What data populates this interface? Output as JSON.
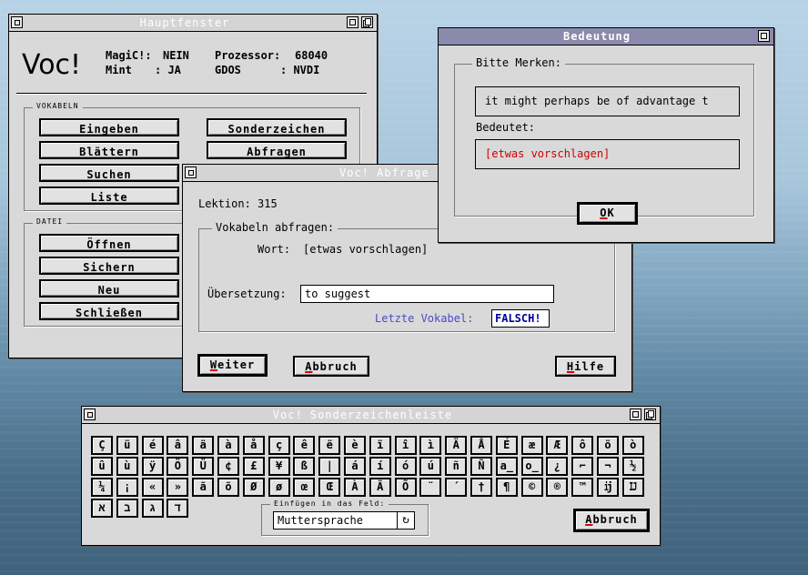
{
  "main_window": {
    "title": "Hauptfenster",
    "logo": "Voc!",
    "info": {
      "magic_label": "MagiC!:",
      "magic_value": "NEIN",
      "mint_label": "Mint",
      "mint_value": ": JA",
      "cpu_label": "Prozessor:",
      "cpu_value": "68040",
      "gdos_label": "GDOS",
      "gdos_value": ": NVDI"
    },
    "vokabeln_label": "VOKABELN",
    "vokabeln_buttons": [
      "Eingeben",
      "Blättern",
      "Suchen",
      "Liste"
    ],
    "vokabeln_buttons_right": [
      "Sonderzeichen",
      "Abfragen"
    ],
    "datei_label": "DATEI",
    "datei_buttons": [
      "Öffnen",
      "Sichern",
      "Neu",
      "Schließen"
    ]
  },
  "quiz_window": {
    "title": "Voc!  Abfrage",
    "lektion": "Lektion: 315",
    "group_label": "Vokabeln abfragen:",
    "wort_label": "Wort:",
    "wort_value": "[etwas vorschlagen]",
    "uebersetzung_label": "Übersetzung:",
    "uebersetzung_value": "to suggest",
    "letzte_label": "Letzte Vokabel:",
    "letzte_value": "FALSCH!",
    "btn_weiter_first": "W",
    "btn_weiter_rest": "eiter",
    "btn_abbruch_first": "A",
    "btn_abbruch_rest": "bbruch",
    "btn_hilfe_first": "H",
    "btn_hilfe_rest": "ilfe"
  },
  "meaning_window": {
    "title": "Bedeutung",
    "group_label": "Bitte Merken:",
    "sentence": "it might perhaps be of advantage t",
    "bedeutet_label": "Bedeutet:",
    "bedeutet_value": "[etwas vorschlagen]",
    "ok_first": "O",
    "ok_rest": "K"
  },
  "special_window": {
    "title": "Voc!  Sonderzeichenleiste",
    "row1": [
      "Ç",
      "ü",
      "é",
      "â",
      "ä",
      "à",
      "å",
      "ç",
      "ê",
      "ë",
      "è",
      "ï",
      "î",
      "ì",
      "Ä",
      "Å",
      "É",
      "æ",
      "Æ",
      "ô",
      "ö",
      "ò"
    ],
    "row2": [
      "û",
      "ù",
      "ÿ",
      "Ö",
      "Ü",
      "¢",
      "£",
      "¥",
      "ß",
      "|",
      "á",
      "í",
      "ó",
      "ú",
      "ñ",
      "Ñ",
      "a̲",
      "o̲",
      "¿",
      "⌐",
      "¬",
      "½"
    ],
    "row3": [
      "¼",
      "¡",
      "«",
      "»",
      "ã",
      "õ",
      "Ø",
      "ø",
      "œ",
      "Œ",
      "À",
      "Ã",
      "Õ",
      "¨",
      "´",
      "†",
      "¶",
      "©",
      "®",
      "™",
      "ĳ",
      "Ĳ"
    ],
    "row4": [
      "א",
      "ב",
      "ג",
      "ד"
    ],
    "insert_label": "Einfügen in das Feld:",
    "insert_value": "Muttersprache",
    "cycle_icon": "cycle-icon",
    "abbruch_first": "A",
    "abbruch_rest": "bbruch"
  },
  "colors": {
    "title_active": "#8a8aac",
    "red_text": "#d00000",
    "blue_text": "#4040c0",
    "falsch": "#0000a0"
  }
}
